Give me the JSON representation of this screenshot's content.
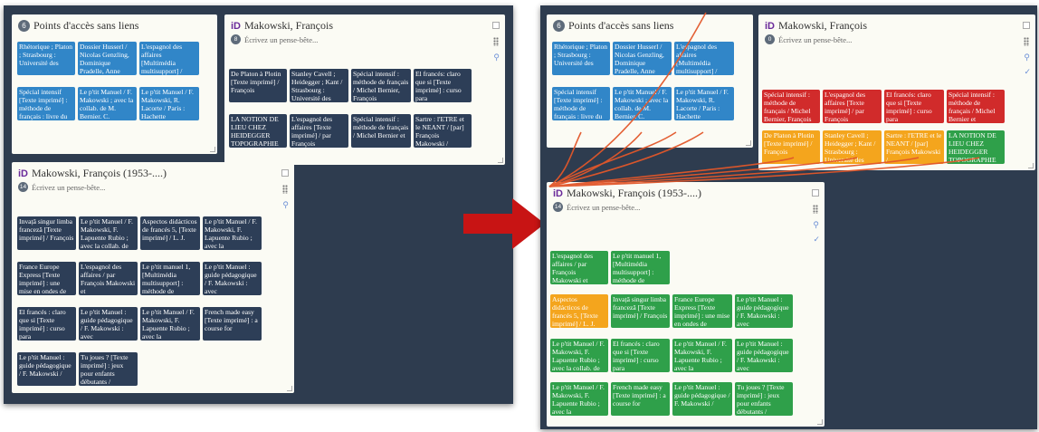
{
  "left": {
    "points_card": {
      "count": "6",
      "title": "Points d'accès sans liens",
      "tiles": [
        "Rhétorique ; Platon ; Strasbourg : Université des",
        "Dossier Husserl / Nicolas Genzling, Dominique Pradelle, Anne",
        "L'espagnol des affaires [Multimédia multisupport] /",
        "Spécial intensif [Texte imprimé] : méthode de français : livre du",
        "Le p'tit Manuel / F. Makowski ; avec la collab. de M. Bernier. C.",
        "Le p'tit Manuel / F. Makowski, R. Lacorte / Paris : Hachette"
      ]
    },
    "mak_card": {
      "title": "Makowski, François",
      "note_count": "8",
      "note_placeholder": "Écrivez un pense-bête...",
      "tiles": [
        "De Platon à Plotin [Texte imprimé] / François",
        "Stanley Cavell ; Heidegger ; Kant / Strasbourg : Université des",
        "Spécial intensif : méthode de français / Michel Bernier, François",
        "El francés: claro que si [Texte imprimé] : curso para",
        "LA NOTION DE LIEU CHEZ HEIDEGGER TOPOGRAPHIE",
        "L'espagnol des affaires [Texte imprimé] / par François",
        "Spécial intensif : méthode de français / Michel Bernier et",
        "Sartre : l'ETRE et le NEANT / [par] François Makowski /"
      ]
    },
    "mak53_card": {
      "title": "Makowski, François (1953-....)",
      "note_count": "14",
      "note_placeholder": "Écrivez un pense-bête...",
      "tiles": [
        "Invață singur limba franceză [Texte imprimé] / François",
        "Le p'tit Manuel / F. Makowski, F. Lapuente Rubio ; avec la collab. de",
        "Aspectos didácticos de francés 5, [Texte imprimé] / L. J.",
        "Le p'tit Manuel / F. Makowski, F. Lapuente Rubio ; avec la",
        "France Europe Express [Texte imprimé] : une mise en ondes de",
        "L'espagnol des affaires / par François Makowski et",
        "Le p'tit manuel 1, [Multimédia multisupport] : méthode de",
        "Le p'tit Manuel : guide pédagogique / F. Makowski : avec",
        "El francés : claro que si [Texte imprimé] : curso para",
        "Le p'tit Manuel : guide pédagogique / F. Makowski : avec",
        "Le p'tit Manuel / F. Makowski, F. Lapuente Rubio ; avec la",
        "French made easy [Texte imprimé] : a course for",
        "Le p'tit Manuel : guide pédagogique / F. Makowski /",
        "Tu joues ? [Texte imprimé] : jeux pour enfants débutants /"
      ]
    }
  },
  "right": {
    "points_card": {
      "count": "6",
      "title": "Points d'accès sans liens",
      "tiles": [
        "Rhétorique ; Platon ; Strasbourg : Université des",
        "Dossier Husserl / Nicolas Genzling, Dominique Pradelle, Anne",
        "L'espagnol des affaires [Multimédia multisupport] /",
        "Spécial intensif [Texte imprimé] : méthode de français : livre du",
        "Le p'tit Manuel / F. Makowski ; avec la collab. de M. Bernier. C.",
        "Le p'tit Manuel / F. Makowski, R. Lacorte / Paris : Hachette"
      ]
    },
    "mak_card": {
      "title": "Makowski, François",
      "note_count": "0",
      "note_placeholder": "Écrivez un pense-bête...",
      "tiles": [
        "Spécial intensif : méthode de français / Michel Bernier, François",
        "L'espagnol des affaires [Texte imprimé] / par François",
        "El francés: claro que si [Texte imprimé] : curso para",
        "Spécial intensif : méthode de français / Michel Bernier et",
        "De Platon à Plotin [Texte imprimé] / François",
        "Stanley Cavell ; Heidegger ; Kant / Strasbourg : Université des",
        "Sartre : l'ETRE et le NEANT / [par] François Makowski /",
        "LA NOTION DE LIEU CHEZ HEIDEGGER TOPOGRAPHIE"
      ]
    },
    "mak53_card": {
      "title": "Makowski, François (1953-....)",
      "note_count": "14",
      "note_placeholder": "Écrivez un pense-bête...",
      "tiles": [
        "L'espagnol des affaires / par François Makowski et",
        "Le p'tit manuel 1, [Multimédia multisupport] : méthode de",
        "Aspectos didácticos de francés 5, [Texte imprimé] / L. J.",
        "Invață singur limba franceză [Texte imprimé] / François",
        "France Europe Express [Texte imprimé] : une mise en ondes de",
        "Le p'tit Manuel : guide pédagogique / F. Makowski : avec",
        "Le p'tit Manuel / F. Makowski, F. Lapuente Rubio ; avec la collab. de",
        "El francés : claro que si [Texte imprimé] : curso para",
        "Le p'tit Manuel / F. Makowski, F. Lapuente Rubio ; avec la",
        "Le p'tit Manuel : guide pédagogique / F. Makowski : avec",
        "Le p'tit Manuel / F. Makowski, F. Lapuente Rubio ; avec la",
        "French made easy [Texte imprimé] : a course for",
        "Le p'tit Manuel : guide pédagogique / F. Makowski /",
        "Tu joues ? [Texte imprimé] : jeux pour enfants débutants /"
      ]
    }
  },
  "colors": {
    "screen_bg": "#2e3c4f",
    "blue_tile": "#3186c8",
    "navy_tile": "#2d3e57",
    "red_tile": "#d12b2b",
    "green_tile": "#2fa04a",
    "orange_tile": "#f4a51d",
    "arrow": "#c81414",
    "link_line": "#e2572a"
  }
}
